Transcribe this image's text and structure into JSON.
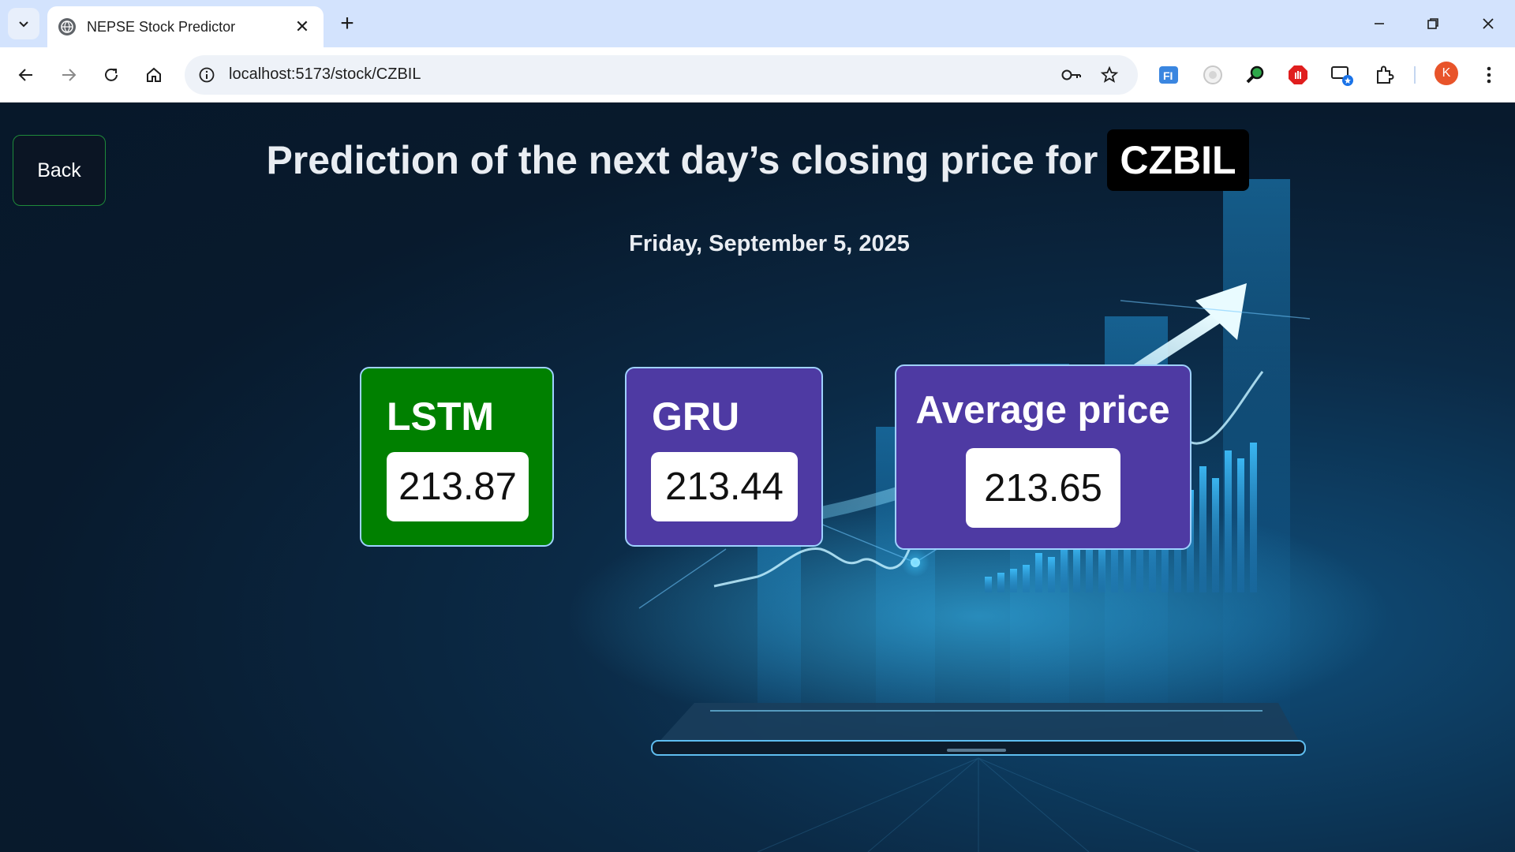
{
  "browser": {
    "tab_title": "NEPSE Stock Predictor",
    "tab_close": "✕",
    "new_tab": "+",
    "url": "localhost:5173/stock/CZBIL",
    "profile_initial": "K"
  },
  "page": {
    "back_label": "Back",
    "headline": "Prediction of the next day’s closing price for",
    "ticker": "CZBIL",
    "date": "Friday, September 5, 2025"
  },
  "predictions": [
    {
      "model": "LSTM",
      "value": "213.87",
      "color": "#008000"
    },
    {
      "model": "GRU",
      "value": "213.44",
      "color": "#4e3aa3"
    },
    {
      "model": "Average price",
      "value": "213.65",
      "color": "#4e3aa3"
    }
  ]
}
